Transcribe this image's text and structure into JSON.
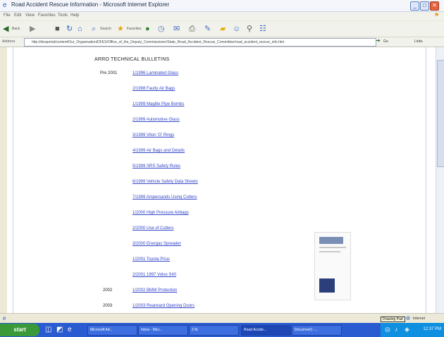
{
  "window": {
    "title": "Road Accident Rescue Information - Microsoft Internet Explorer",
    "buttons": {
      "minimize": "_",
      "maximize": "□",
      "close": "✕"
    }
  },
  "menu": [
    "File",
    "Edit",
    "View",
    "Favorites",
    "Tools",
    "Help"
  ],
  "toolbar": {
    "back": "Back",
    "search": "Search",
    "favorites": "Favorites"
  },
  "address": {
    "label": "Address",
    "url": "http://desportal/content/Our_Organisation/DFES/Office_of_the_Deputy_Commissioner/State_Road_Accident_Rescue_Committee/road_accident_rescue_info.htm",
    "go": "Go",
    "links": "Links"
  },
  "content": {
    "heading": "ARRO TECHNICAL BULLETINS",
    "groups": [
      {
        "year": "Pre 2001",
        "bulletins": [
          "1/1996 Laminated Glass",
          "2/1998 Faulty Air Bags",
          "1/1999 Maglite Pipe Bombs",
          "2/1999 Automotive Glass",
          "3/1999 Viton 'O' Rings",
          "4/1999 Air Bags and Details",
          "5/1999 SRS Safety Rules",
          "6/1999 Vehicle Safety Data Sheets",
          "7/1999 Ampersands Using Cutters",
          "1/2000 High Pressure Airbags",
          "2/2000 Use of Cutters",
          "3/2000 Energac Spreader",
          "1/2001 Toyota Prius",
          "2/2001 1997 Volvo S40"
        ]
      },
      {
        "year": "2002",
        "bulletins": [
          "1/2002 BMW Protection"
        ]
      },
      {
        "year": "2003",
        "bulletins": [
          "1/2003 Rearward Opening Doors"
        ]
      }
    ]
  },
  "status": {
    "tooltip": "Drawing Pad",
    "zone": "Internet"
  },
  "taskbar": {
    "start": "start",
    "tasks": [
      "Microsoft Ad...",
      "Inbox - Micr...",
      "2 IE",
      "Road Accide...",
      "Document1 -..."
    ],
    "clock": "12:37 PM"
  }
}
